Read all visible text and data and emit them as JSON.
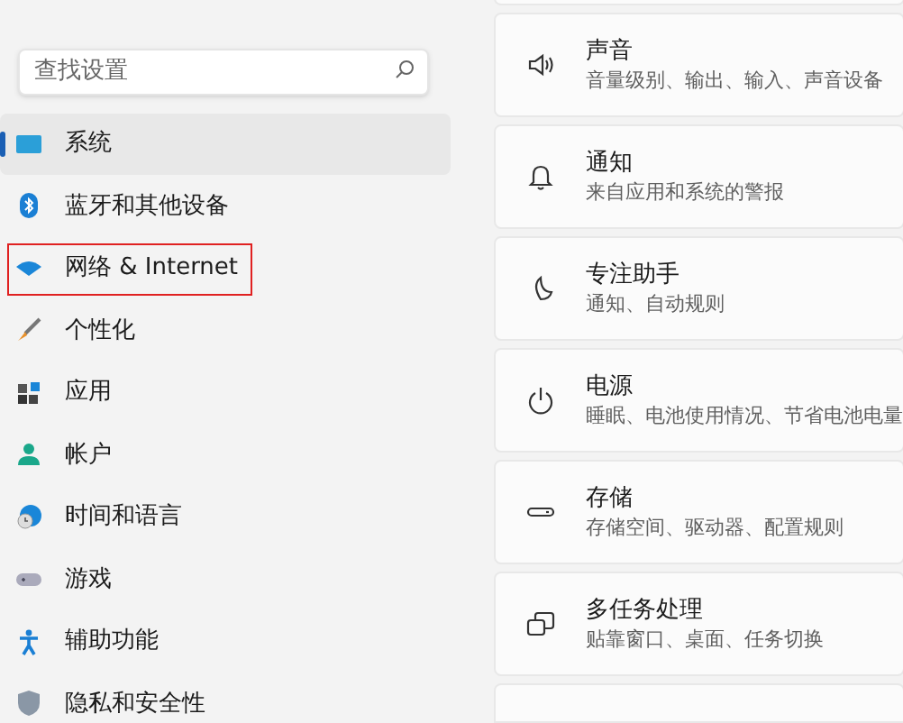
{
  "search": {
    "placeholder": "查找设置"
  },
  "sidebar": {
    "items": [
      {
        "label": "系统",
        "kind": "system",
        "selected": true,
        "outlined": false
      },
      {
        "label": "蓝牙和其他设备",
        "kind": "bluetooth",
        "selected": false,
        "outlined": false
      },
      {
        "label": "网络 & Internet",
        "kind": "network",
        "selected": false,
        "outlined": true
      },
      {
        "label": "个性化",
        "kind": "personalize",
        "selected": false,
        "outlined": false
      },
      {
        "label": "应用",
        "kind": "apps",
        "selected": false,
        "outlined": false
      },
      {
        "label": "帐户",
        "kind": "account",
        "selected": false,
        "outlined": false
      },
      {
        "label": "时间和语言",
        "kind": "time",
        "selected": false,
        "outlined": false
      },
      {
        "label": "游戏",
        "kind": "gaming",
        "selected": false,
        "outlined": false
      },
      {
        "label": "辅助功能",
        "kind": "accessibility",
        "selected": false,
        "outlined": false
      },
      {
        "label": "隐私和安全性",
        "kind": "privacy",
        "selected": false,
        "outlined": false
      }
    ]
  },
  "settings": [
    {
      "title": "声音",
      "subtitle": "音量级别、输出、输入、声音设备",
      "kind": "sound"
    },
    {
      "title": "通知",
      "subtitle": "来自应用和系统的警报",
      "kind": "bell"
    },
    {
      "title": "专注助手",
      "subtitle": "通知、自动规则",
      "kind": "moon"
    },
    {
      "title": "电源",
      "subtitle": "睡眠、电池使用情况、节省电池电量",
      "kind": "power"
    },
    {
      "title": "存储",
      "subtitle": "存储空间、驱动器、配置规则",
      "kind": "storage"
    },
    {
      "title": "多任务处理",
      "subtitle": "贴靠窗口、桌面、任务切换",
      "kind": "multitask"
    }
  ]
}
